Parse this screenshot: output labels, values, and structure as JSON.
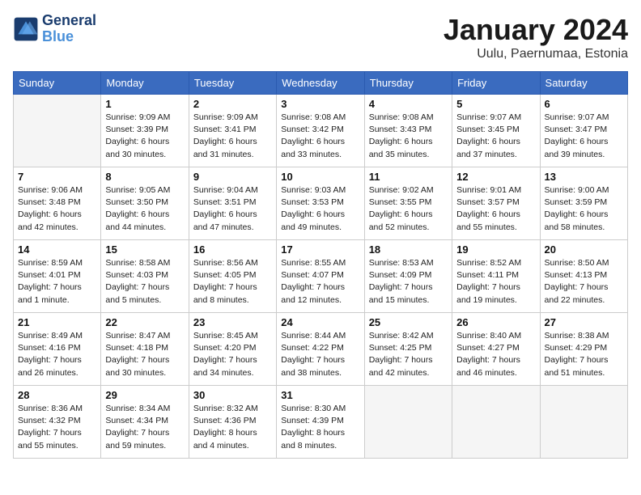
{
  "logo": {
    "line1": "General",
    "line2": "Blue"
  },
  "title": "January 2024",
  "location": "Uulu, Paernumaa, Estonia",
  "days_of_week": [
    "Sunday",
    "Monday",
    "Tuesday",
    "Wednesday",
    "Thursday",
    "Friday",
    "Saturday"
  ],
  "weeks": [
    [
      {
        "day": "",
        "info": ""
      },
      {
        "day": "1",
        "info": "Sunrise: 9:09 AM\nSunset: 3:39 PM\nDaylight: 6 hours\nand 30 minutes."
      },
      {
        "day": "2",
        "info": "Sunrise: 9:09 AM\nSunset: 3:41 PM\nDaylight: 6 hours\nand 31 minutes."
      },
      {
        "day": "3",
        "info": "Sunrise: 9:08 AM\nSunset: 3:42 PM\nDaylight: 6 hours\nand 33 minutes."
      },
      {
        "day": "4",
        "info": "Sunrise: 9:08 AM\nSunset: 3:43 PM\nDaylight: 6 hours\nand 35 minutes."
      },
      {
        "day": "5",
        "info": "Sunrise: 9:07 AM\nSunset: 3:45 PM\nDaylight: 6 hours\nand 37 minutes."
      },
      {
        "day": "6",
        "info": "Sunrise: 9:07 AM\nSunset: 3:47 PM\nDaylight: 6 hours\nand 39 minutes."
      }
    ],
    [
      {
        "day": "7",
        "info": "Sunrise: 9:06 AM\nSunset: 3:48 PM\nDaylight: 6 hours\nand 42 minutes."
      },
      {
        "day": "8",
        "info": "Sunrise: 9:05 AM\nSunset: 3:50 PM\nDaylight: 6 hours\nand 44 minutes."
      },
      {
        "day": "9",
        "info": "Sunrise: 9:04 AM\nSunset: 3:51 PM\nDaylight: 6 hours\nand 47 minutes."
      },
      {
        "day": "10",
        "info": "Sunrise: 9:03 AM\nSunset: 3:53 PM\nDaylight: 6 hours\nand 49 minutes."
      },
      {
        "day": "11",
        "info": "Sunrise: 9:02 AM\nSunset: 3:55 PM\nDaylight: 6 hours\nand 52 minutes."
      },
      {
        "day": "12",
        "info": "Sunrise: 9:01 AM\nSunset: 3:57 PM\nDaylight: 6 hours\nand 55 minutes."
      },
      {
        "day": "13",
        "info": "Sunrise: 9:00 AM\nSunset: 3:59 PM\nDaylight: 6 hours\nand 58 minutes."
      }
    ],
    [
      {
        "day": "14",
        "info": "Sunrise: 8:59 AM\nSunset: 4:01 PM\nDaylight: 7 hours\nand 1 minute."
      },
      {
        "day": "15",
        "info": "Sunrise: 8:58 AM\nSunset: 4:03 PM\nDaylight: 7 hours\nand 5 minutes."
      },
      {
        "day": "16",
        "info": "Sunrise: 8:56 AM\nSunset: 4:05 PM\nDaylight: 7 hours\nand 8 minutes."
      },
      {
        "day": "17",
        "info": "Sunrise: 8:55 AM\nSunset: 4:07 PM\nDaylight: 7 hours\nand 12 minutes."
      },
      {
        "day": "18",
        "info": "Sunrise: 8:53 AM\nSunset: 4:09 PM\nDaylight: 7 hours\nand 15 minutes."
      },
      {
        "day": "19",
        "info": "Sunrise: 8:52 AM\nSunset: 4:11 PM\nDaylight: 7 hours\nand 19 minutes."
      },
      {
        "day": "20",
        "info": "Sunrise: 8:50 AM\nSunset: 4:13 PM\nDaylight: 7 hours\nand 22 minutes."
      }
    ],
    [
      {
        "day": "21",
        "info": "Sunrise: 8:49 AM\nSunset: 4:16 PM\nDaylight: 7 hours\nand 26 minutes."
      },
      {
        "day": "22",
        "info": "Sunrise: 8:47 AM\nSunset: 4:18 PM\nDaylight: 7 hours\nand 30 minutes."
      },
      {
        "day": "23",
        "info": "Sunrise: 8:45 AM\nSunset: 4:20 PM\nDaylight: 7 hours\nand 34 minutes."
      },
      {
        "day": "24",
        "info": "Sunrise: 8:44 AM\nSunset: 4:22 PM\nDaylight: 7 hours\nand 38 minutes."
      },
      {
        "day": "25",
        "info": "Sunrise: 8:42 AM\nSunset: 4:25 PM\nDaylight: 7 hours\nand 42 minutes."
      },
      {
        "day": "26",
        "info": "Sunrise: 8:40 AM\nSunset: 4:27 PM\nDaylight: 7 hours\nand 46 minutes."
      },
      {
        "day": "27",
        "info": "Sunrise: 8:38 AM\nSunset: 4:29 PM\nDaylight: 7 hours\nand 51 minutes."
      }
    ],
    [
      {
        "day": "28",
        "info": "Sunrise: 8:36 AM\nSunset: 4:32 PM\nDaylight: 7 hours\nand 55 minutes."
      },
      {
        "day": "29",
        "info": "Sunrise: 8:34 AM\nSunset: 4:34 PM\nDaylight: 7 hours\nand 59 minutes."
      },
      {
        "day": "30",
        "info": "Sunrise: 8:32 AM\nSunset: 4:36 PM\nDaylight: 8 hours\nand 4 minutes."
      },
      {
        "day": "31",
        "info": "Sunrise: 8:30 AM\nSunset: 4:39 PM\nDaylight: 8 hours\nand 8 minutes."
      },
      {
        "day": "",
        "info": ""
      },
      {
        "day": "",
        "info": ""
      },
      {
        "day": "",
        "info": ""
      }
    ]
  ]
}
